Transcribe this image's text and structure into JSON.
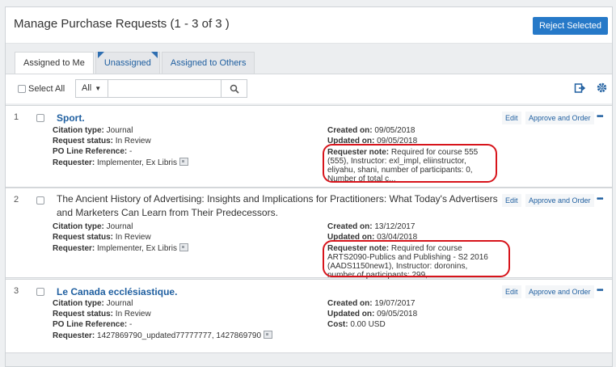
{
  "header": {
    "title": "Manage Purchase Requests (1 - 3 of 3 )",
    "reject_label": "Reject Selected"
  },
  "tabs": [
    {
      "label": "Assigned to Me"
    },
    {
      "label": "Unassigned"
    },
    {
      "label": "Assigned to Others"
    }
  ],
  "toolbar": {
    "select_all": "Select All",
    "filter_value": "All",
    "search_value": "",
    "search_placeholder": ""
  },
  "actions": {
    "edit": "Edit",
    "approve": "Approve and Order",
    "more": "•••"
  },
  "labels": {
    "citation_type": "Citation type:",
    "request_status": "Request status:",
    "po_line": "PO Line Reference:",
    "requester": "Requester:",
    "created_on": "Created on:",
    "updated_on": "Updated on:",
    "requester_note": "Requester note:",
    "cost": "Cost:"
  },
  "rows": [
    {
      "num": "1",
      "title": "Sport.",
      "citation_type": "Journal",
      "request_status": "In Review",
      "po_line": "-",
      "requester": "Implementer, Ex Libris",
      "created_on": "09/05/2018",
      "updated_on": "09/05/2018",
      "note": "Required for course 555 (555), Instructor: exl_impl, eliinstructor, eliyahu, shani, number of participants: 0, Number of total c..."
    },
    {
      "num": "2",
      "title": "The Ancient History of Advertising: Insights and Implications for Practitioners: What Today's Advertisers and Marketers Can Learn from Their Predecessors.",
      "citation_type": "Journal",
      "request_status": "In Review",
      "requester": "Implementer, Ex Libris",
      "created_on": "13/12/2017",
      "updated_on": "03/04/2018",
      "note": "Required for course ARTS2090-Publics and Publishing - S2 2016 (AADS1150new1), Instructor: doronins, number of participants: 299,..."
    },
    {
      "num": "3",
      "title": "Le Canada ecclésiastique.",
      "citation_type": "Journal",
      "request_status": "In Review",
      "po_line": "-",
      "requester": "1427869790_updated77777777, 1427869790",
      "created_on": "19/07/2017",
      "updated_on": "09/05/2018",
      "cost": "0.00 USD"
    }
  ]
}
